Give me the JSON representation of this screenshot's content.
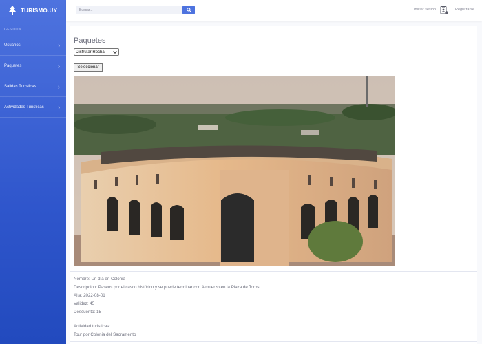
{
  "brand": {
    "name": "TURISMO.UY",
    "icon": "tree-icon"
  },
  "sidebar": {
    "section_title": "GESTION",
    "items": [
      {
        "label": "Usuarios"
      },
      {
        "label": "Paquetes"
      },
      {
        "label": "Salidas Turisticas"
      },
      {
        "label": "Actividades Turisticas"
      }
    ]
  },
  "topbar": {
    "search_placeholder": "Buscar...",
    "login_label": "Iniciar sesión",
    "register_label": "Registrarse"
  },
  "main": {
    "title": "Paquetes",
    "select_value": "Disfrutar Rocha",
    "select_button": "Seleccionar",
    "details": {
      "nombre": "Nombre: Un día en Colonia",
      "descripcion": "Descripcion: Paseos por el casco histórico y se puede terminar con Almuerzo en la Plaza de Toros",
      "alta": "Alta: 2022-08-01",
      "validez": "Validez: 45",
      "descuento": "Descuento: 15"
    },
    "activities_label": "Actividad turisticas:",
    "activities": [
      "Tour por Colonia del Sacramento"
    ]
  },
  "colors": {
    "accent": "#4e73df",
    "text_muted": "#6e707e"
  }
}
